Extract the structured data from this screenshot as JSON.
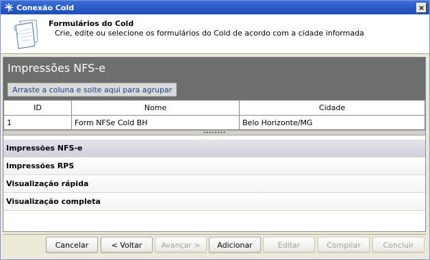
{
  "window": {
    "title": "Conexão Cold",
    "close_glyph": "×"
  },
  "header": {
    "title": "Formulários do Cold",
    "subtitle": "Crie, edite ou selecione os formulários do Cold de acordo com a cidade informada",
    "icon": "document-icon"
  },
  "grid": {
    "title": "Impressões NFS-e",
    "group_hint": "Arraste a coluna e solte aqui para agrupar",
    "columns": [
      "ID",
      "Nome",
      "Cidade"
    ],
    "rows": [
      [
        "1",
        "Form NFSe Cold BH",
        "Belo Horizonte/MG"
      ]
    ],
    "splitter_grip": "••••••••"
  },
  "sections": [
    {
      "label": "Impressões NFS-e",
      "active": true
    },
    {
      "label": "Impressões RPS",
      "active": false
    },
    {
      "label": "Visualização rápida",
      "active": false
    },
    {
      "label": "Visualização completa",
      "active": false
    }
  ],
  "buttons": {
    "cancel": "Cancelar",
    "back": "< Voltar",
    "next": "Avançar >",
    "add": "Adicionar",
    "edit": "Editar",
    "compile": "Compilar",
    "finish": "Concluir"
  },
  "colors": {
    "titlebar": "#2a5bc7",
    "grid_header": "#6d6e6e",
    "group_text": "#1c3e8a"
  }
}
